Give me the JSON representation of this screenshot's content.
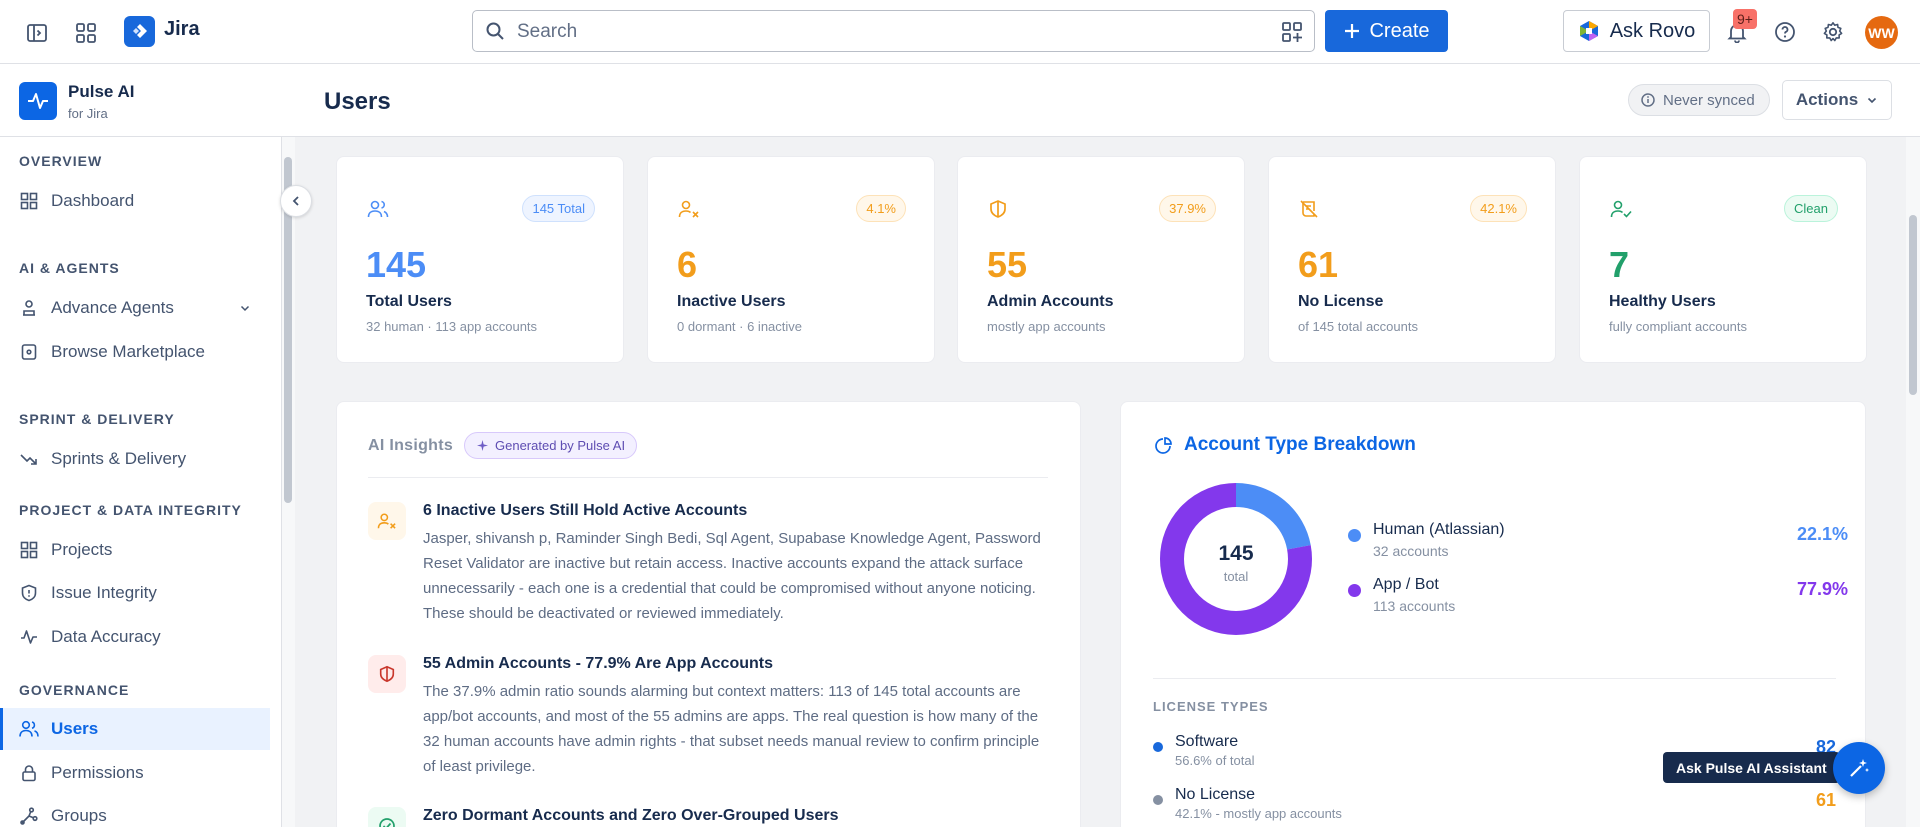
{
  "topbar": {
    "product": "Jira",
    "search_placeholder": "Search",
    "create_label": "Create",
    "ask_rovo_label": "Ask Rovo",
    "notification_count": "9+",
    "avatar_initials": "WW",
    "icons": [
      "sidebar-toggle-icon",
      "app-switcher-icon",
      "jira-logo-icon",
      "search-icon",
      "qr-filter-icon",
      "plus-icon",
      "rovo-icon",
      "bell-icon",
      "help-icon",
      "gear-icon"
    ]
  },
  "app": {
    "name": "Pulse AI",
    "subtitle": "for Jira"
  },
  "page": {
    "title": "Users",
    "sync_status": "Never synced",
    "actions_label": "Actions"
  },
  "sidebar": {
    "sections": {
      "overview": "OVERVIEW",
      "ai_agents": "AI & AGENTS",
      "sprint_delivery": "SPRINT & DELIVERY",
      "project_integrity": "PROJECT & DATA INTEGRITY",
      "governance": "GOVERNANCE"
    },
    "items": {
      "dashboard": "Dashboard",
      "advance_agents": "Advance Agents",
      "browse_marketplace": "Browse Marketplace",
      "sprints": "Sprints & Delivery",
      "projects": "Projects",
      "issue_integrity": "Issue Integrity",
      "data_accuracy": "Data Accuracy",
      "users": "Users",
      "permissions": "Permissions",
      "groups": "Groups"
    },
    "active_item": "users"
  },
  "stats": [
    {
      "badge": "145 Total",
      "value": "145",
      "label": "Total Users",
      "sub": "32 human · 113 app accounts",
      "color": "#4c8df6",
      "icon": "users-icon"
    },
    {
      "badge": "4.1%",
      "value": "6",
      "label": "Inactive Users",
      "sub": "0 dormant · 6 inactive",
      "color": "#f29d1b",
      "icon": "user-x-icon"
    },
    {
      "badge": "37.9%",
      "value": "55",
      "label": "Admin Accounts",
      "sub": "mostly app accounts",
      "color": "#f29d1b",
      "icon": "shield-icon"
    },
    {
      "badge": "42.1%",
      "value": "61",
      "label": "No License",
      "sub": "of 145 total accounts",
      "color": "#f29d1b",
      "icon": "no-license-icon"
    },
    {
      "badge": "Clean",
      "value": "7",
      "label": "Healthy Users",
      "sub": "fully compliant accounts",
      "color": "#22a06b",
      "icon": "user-check-icon"
    }
  ],
  "insights": {
    "heading": "AI Insights",
    "badge": "Generated by Pulse AI",
    "items": [
      {
        "title": "6 Inactive Users Still Hold Active Accounts",
        "body": "Jasper, shivansh p, Raminder Singh Bedi, Sql Agent, Supabase Knowledge Agent, Password Reset Validator are inactive but retain access. Inactive accounts expand the attack surface unnecessarily - each one is a credential that could be compromised without anyone noticing. These should be deactivated or reviewed immediately.",
        "icon": "user-x-icon"
      },
      {
        "title": "55 Admin Accounts - 77.9% Are App Accounts",
        "body": "The 37.9% admin ratio sounds alarming but context matters: 113 of 145 total accounts are app/bot accounts, and most of the 55 admins are apps. The real question is how many of the 32 human accounts have admin rights - that subset needs manual review to confirm principle of least privilege.",
        "icon": "shield-icon"
      },
      {
        "title": "Zero Dormant Accounts and Zero Over-Grouped Users",
        "body": "",
        "icon": "check-circle-icon"
      }
    ]
  },
  "breakdown": {
    "title": "Account Type Breakdown",
    "center_value": "145",
    "center_label": "total",
    "legend": [
      {
        "name": "Human (Atlassian)",
        "sub": "32 accounts",
        "pct": "22.1%",
        "value": 32,
        "color": "#4c8df6"
      },
      {
        "name": "App / Bot",
        "sub": "113 accounts",
        "pct": "77.9%",
        "value": 113,
        "color": "#8338ec"
      }
    ],
    "license_heading": "LICENSE TYPES",
    "licenses": [
      {
        "name": "Software",
        "sub": "56.6% of total",
        "value": "82",
        "color": "#1868db"
      },
      {
        "name": "No License",
        "sub": "42.1% - mostly app accounts",
        "value": "61",
        "color": "#f29d1b"
      }
    ]
  },
  "assistant": {
    "tooltip": "Ask Pulse AI Assistant"
  }
}
